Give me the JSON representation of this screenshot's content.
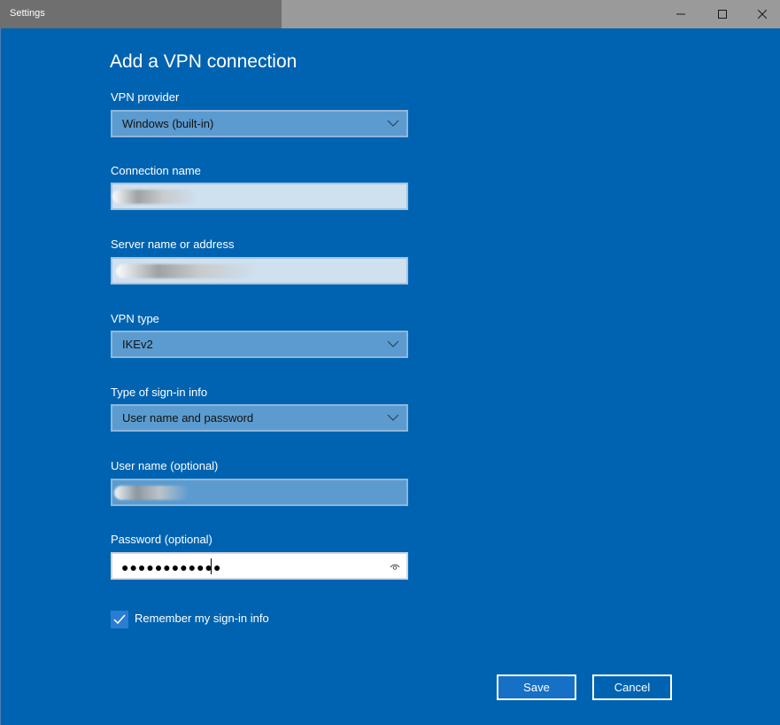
{
  "window": {
    "title": "Settings",
    "minimize_glyph": "—",
    "maximize_glyph": "☐",
    "close_glyph": "✕"
  },
  "page": {
    "heading": "Add a VPN connection"
  },
  "form": {
    "vpn_provider": {
      "label": "VPN provider",
      "value": "Windows (built-in)"
    },
    "connection_name": {
      "label": "Connection name",
      "value": ""
    },
    "server_name": {
      "label": "Server name or address",
      "value": ""
    },
    "vpn_type": {
      "label": "VPN type",
      "value": "IKEv2"
    },
    "sign_in_type": {
      "label": "Type of sign-in info",
      "value": "User name and password"
    },
    "user_name": {
      "label": "User name (optional)",
      "value": ""
    },
    "password": {
      "label": "Password (optional)",
      "masked_value": "●●●●●●●●●●●●"
    },
    "remember": {
      "label": "Remember my sign-in info",
      "checked": true
    }
  },
  "buttons": {
    "save": "Save",
    "cancel": "Cancel"
  },
  "colors": {
    "background": "#0063B1",
    "titlebar": "#9a9a9a",
    "accent": "#2b7cd3"
  }
}
